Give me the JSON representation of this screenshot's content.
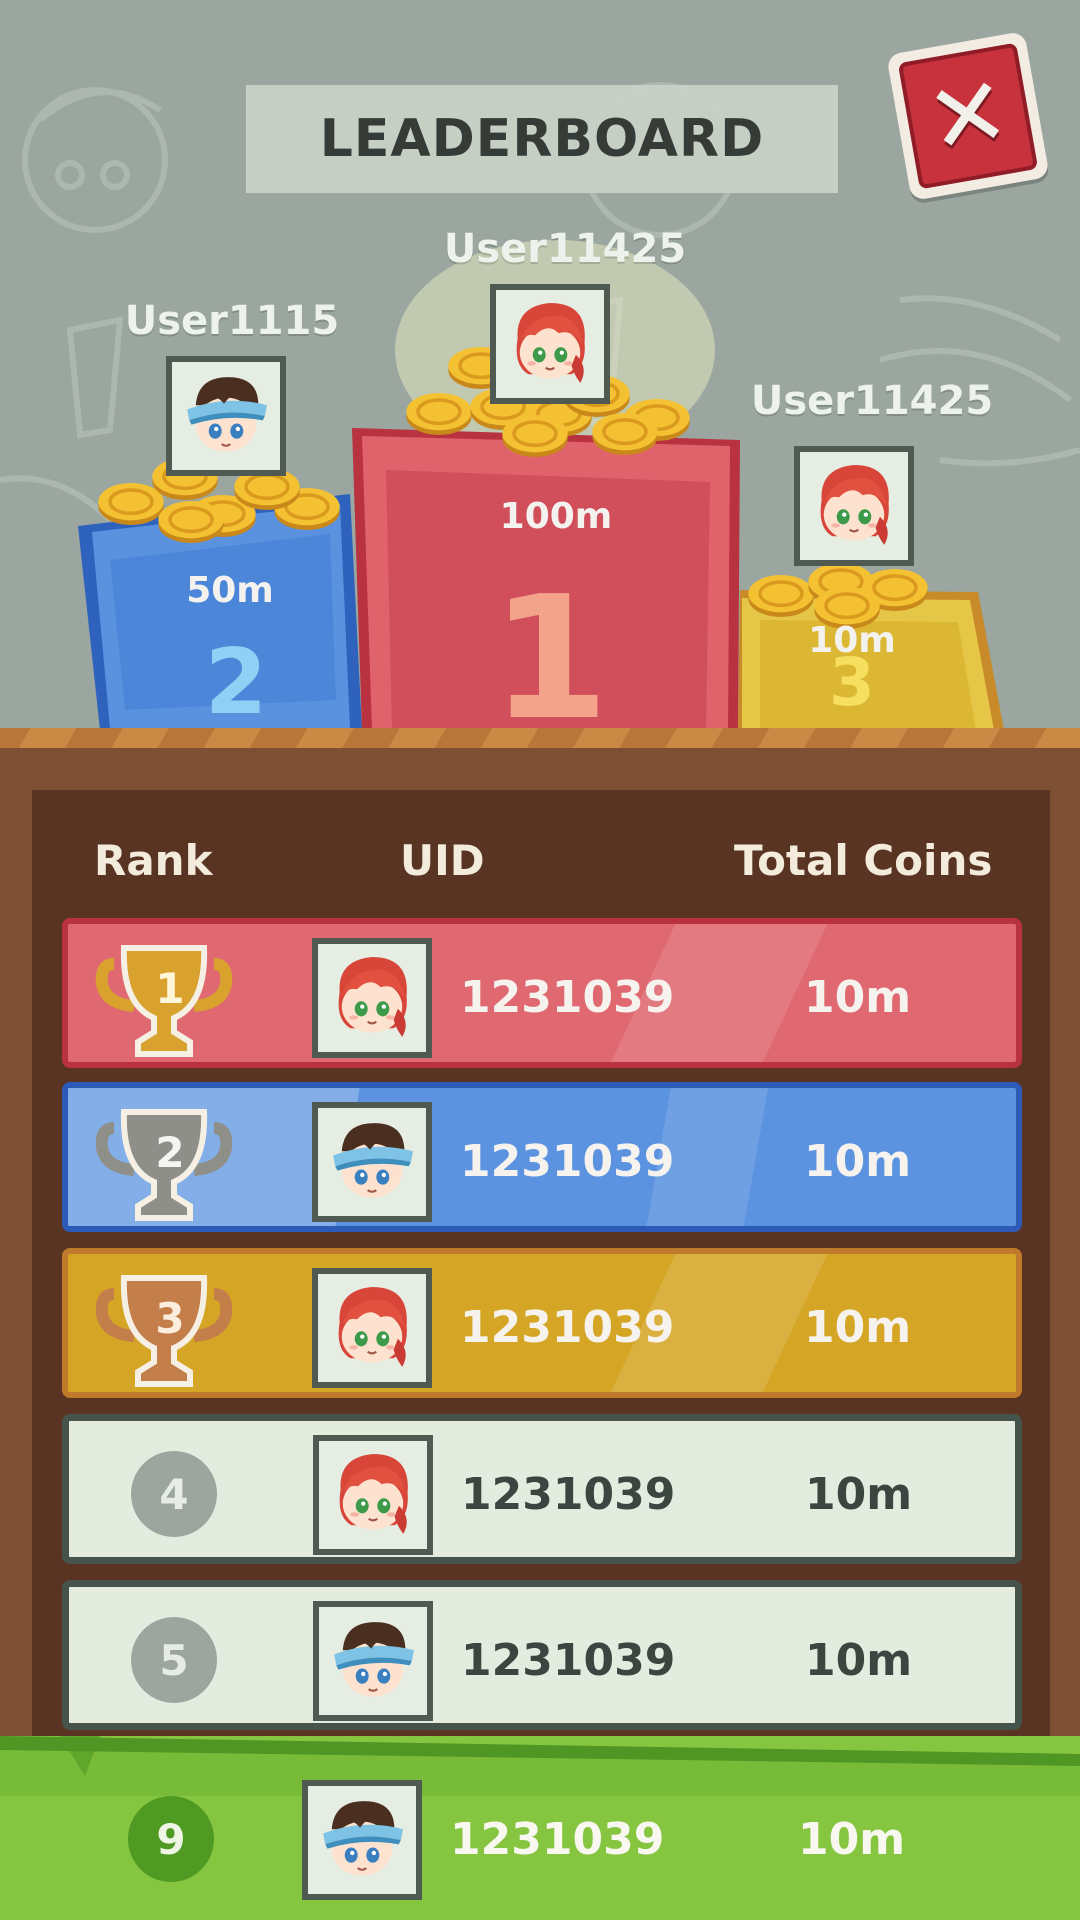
{
  "header": {
    "title": "LEADERBOARD",
    "close_icon": "close-icon"
  },
  "podium": [
    {
      "place": "2",
      "name": "User1115",
      "distance": "50m",
      "avatar": "boy-visor-avatar",
      "color": "#4c86d8"
    },
    {
      "place": "1",
      "name": "User11425",
      "distance": "100m",
      "avatar": "redhead-avatar",
      "color": "#d94f5d"
    },
    {
      "place": "3",
      "name": "User11425",
      "distance": "10m",
      "avatar": "redhead-avatar",
      "color": "#e0b732"
    }
  ],
  "table": {
    "columns": [
      "Rank",
      "UID",
      "Total Coins"
    ],
    "rows": [
      {
        "rank": "1",
        "uid": "1231039",
        "coins": "10m",
        "avatar": "redhead-avatar",
        "style": "gold-trophy"
      },
      {
        "rank": "2",
        "uid": "1231039",
        "coins": "10m",
        "avatar": "boy-visor-avatar",
        "style": "silver-trophy"
      },
      {
        "rank": "3",
        "uid": "1231039",
        "coins": "10m",
        "avatar": "redhead-avatar",
        "style": "bronze-trophy"
      },
      {
        "rank": "4",
        "uid": "1231039",
        "coins": "10m",
        "avatar": "redhead-avatar",
        "style": "plain"
      },
      {
        "rank": "5",
        "uid": "1231039",
        "coins": "10m",
        "avatar": "boy-visor-avatar",
        "style": "plain"
      }
    ]
  },
  "my_rank": {
    "rank": "9",
    "uid": "1231039",
    "coins": "10m",
    "avatar": "boy-visor-avatar"
  },
  "colors": {
    "background": "#9aa69f",
    "board": "#5a3422",
    "grass": "#86c540"
  }
}
